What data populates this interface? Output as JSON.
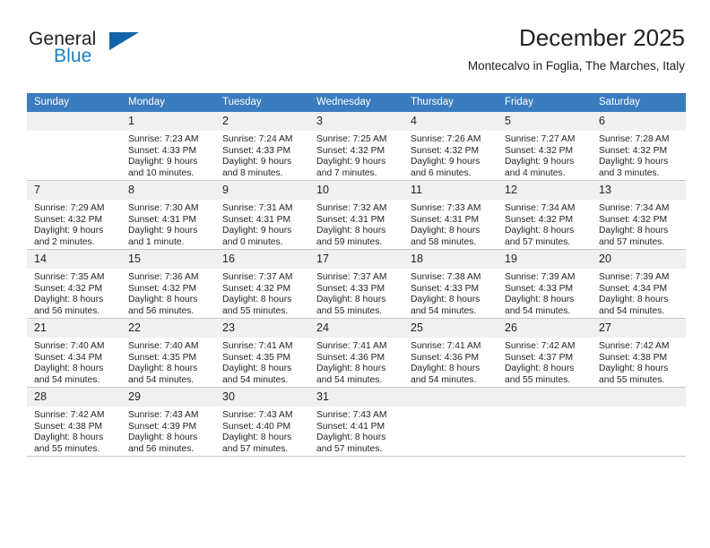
{
  "brand": {
    "name_top": "General",
    "name_bottom": "Blue",
    "triangle_color": "#1164ab",
    "blue_color": "#1a7fc1"
  },
  "header": {
    "title": "December 2025",
    "location": "Montecalvo in Foglia, The Marches, Italy"
  },
  "theme": {
    "header_row_bg": "#3a7cbe",
    "daynum_bg": "#f0f0f0",
    "cell_border": "#c8c8c8",
    "text_color": "#231f20"
  },
  "weekday_headers": [
    "Sunday",
    "Monday",
    "Tuesday",
    "Wednesday",
    "Thursday",
    "Friday",
    "Saturday"
  ],
  "weeks": [
    [
      {
        "day": "",
        "empty": true,
        "sunrise": "",
        "sunset": "",
        "daylight_line1": "",
        "daylight_line2": ""
      },
      {
        "day": "1",
        "empty": false,
        "sunrise": "Sunrise: 7:23 AM",
        "sunset": "Sunset: 4:33 PM",
        "daylight_line1": "Daylight: 9 hours",
        "daylight_line2": "and 10 minutes."
      },
      {
        "day": "2",
        "empty": false,
        "sunrise": "Sunrise: 7:24 AM",
        "sunset": "Sunset: 4:33 PM",
        "daylight_line1": "Daylight: 9 hours",
        "daylight_line2": "and 8 minutes."
      },
      {
        "day": "3",
        "empty": false,
        "sunrise": "Sunrise: 7:25 AM",
        "sunset": "Sunset: 4:32 PM",
        "daylight_line1": "Daylight: 9 hours",
        "daylight_line2": "and 7 minutes."
      },
      {
        "day": "4",
        "empty": false,
        "sunrise": "Sunrise: 7:26 AM",
        "sunset": "Sunset: 4:32 PM",
        "daylight_line1": "Daylight: 9 hours",
        "daylight_line2": "and 6 minutes."
      },
      {
        "day": "5",
        "empty": false,
        "sunrise": "Sunrise: 7:27 AM",
        "sunset": "Sunset: 4:32 PM",
        "daylight_line1": "Daylight: 9 hours",
        "daylight_line2": "and 4 minutes."
      },
      {
        "day": "6",
        "empty": false,
        "sunrise": "Sunrise: 7:28 AM",
        "sunset": "Sunset: 4:32 PM",
        "daylight_line1": "Daylight: 9 hours",
        "daylight_line2": "and 3 minutes."
      }
    ],
    [
      {
        "day": "7",
        "empty": false,
        "sunrise": "Sunrise: 7:29 AM",
        "sunset": "Sunset: 4:32 PM",
        "daylight_line1": "Daylight: 9 hours",
        "daylight_line2": "and 2 minutes."
      },
      {
        "day": "8",
        "empty": false,
        "sunrise": "Sunrise: 7:30 AM",
        "sunset": "Sunset: 4:31 PM",
        "daylight_line1": "Daylight: 9 hours",
        "daylight_line2": "and 1 minute."
      },
      {
        "day": "9",
        "empty": false,
        "sunrise": "Sunrise: 7:31 AM",
        "sunset": "Sunset: 4:31 PM",
        "daylight_line1": "Daylight: 9 hours",
        "daylight_line2": "and 0 minutes."
      },
      {
        "day": "10",
        "empty": false,
        "sunrise": "Sunrise: 7:32 AM",
        "sunset": "Sunset: 4:31 PM",
        "daylight_line1": "Daylight: 8 hours",
        "daylight_line2": "and 59 minutes."
      },
      {
        "day": "11",
        "empty": false,
        "sunrise": "Sunrise: 7:33 AM",
        "sunset": "Sunset: 4:31 PM",
        "daylight_line1": "Daylight: 8 hours",
        "daylight_line2": "and 58 minutes."
      },
      {
        "day": "12",
        "empty": false,
        "sunrise": "Sunrise: 7:34 AM",
        "sunset": "Sunset: 4:32 PM",
        "daylight_line1": "Daylight: 8 hours",
        "daylight_line2": "and 57 minutes."
      },
      {
        "day": "13",
        "empty": false,
        "sunrise": "Sunrise: 7:34 AM",
        "sunset": "Sunset: 4:32 PM",
        "daylight_line1": "Daylight: 8 hours",
        "daylight_line2": "and 57 minutes."
      }
    ],
    [
      {
        "day": "14",
        "empty": false,
        "sunrise": "Sunrise: 7:35 AM",
        "sunset": "Sunset: 4:32 PM",
        "daylight_line1": "Daylight: 8 hours",
        "daylight_line2": "and 56 minutes."
      },
      {
        "day": "15",
        "empty": false,
        "sunrise": "Sunrise: 7:36 AM",
        "sunset": "Sunset: 4:32 PM",
        "daylight_line1": "Daylight: 8 hours",
        "daylight_line2": "and 56 minutes."
      },
      {
        "day": "16",
        "empty": false,
        "sunrise": "Sunrise: 7:37 AM",
        "sunset": "Sunset: 4:32 PM",
        "daylight_line1": "Daylight: 8 hours",
        "daylight_line2": "and 55 minutes."
      },
      {
        "day": "17",
        "empty": false,
        "sunrise": "Sunrise: 7:37 AM",
        "sunset": "Sunset: 4:33 PM",
        "daylight_line1": "Daylight: 8 hours",
        "daylight_line2": "and 55 minutes."
      },
      {
        "day": "18",
        "empty": false,
        "sunrise": "Sunrise: 7:38 AM",
        "sunset": "Sunset: 4:33 PM",
        "daylight_line1": "Daylight: 8 hours",
        "daylight_line2": "and 54 minutes."
      },
      {
        "day": "19",
        "empty": false,
        "sunrise": "Sunrise: 7:39 AM",
        "sunset": "Sunset: 4:33 PM",
        "daylight_line1": "Daylight: 8 hours",
        "daylight_line2": "and 54 minutes."
      },
      {
        "day": "20",
        "empty": false,
        "sunrise": "Sunrise: 7:39 AM",
        "sunset": "Sunset: 4:34 PM",
        "daylight_line1": "Daylight: 8 hours",
        "daylight_line2": "and 54 minutes."
      }
    ],
    [
      {
        "day": "21",
        "empty": false,
        "sunrise": "Sunrise: 7:40 AM",
        "sunset": "Sunset: 4:34 PM",
        "daylight_line1": "Daylight: 8 hours",
        "daylight_line2": "and 54 minutes."
      },
      {
        "day": "22",
        "empty": false,
        "sunrise": "Sunrise: 7:40 AM",
        "sunset": "Sunset: 4:35 PM",
        "daylight_line1": "Daylight: 8 hours",
        "daylight_line2": "and 54 minutes."
      },
      {
        "day": "23",
        "empty": false,
        "sunrise": "Sunrise: 7:41 AM",
        "sunset": "Sunset: 4:35 PM",
        "daylight_line1": "Daylight: 8 hours",
        "daylight_line2": "and 54 minutes."
      },
      {
        "day": "24",
        "empty": false,
        "sunrise": "Sunrise: 7:41 AM",
        "sunset": "Sunset: 4:36 PM",
        "daylight_line1": "Daylight: 8 hours",
        "daylight_line2": "and 54 minutes."
      },
      {
        "day": "25",
        "empty": false,
        "sunrise": "Sunrise: 7:41 AM",
        "sunset": "Sunset: 4:36 PM",
        "daylight_line1": "Daylight: 8 hours",
        "daylight_line2": "and 54 minutes."
      },
      {
        "day": "26",
        "empty": false,
        "sunrise": "Sunrise: 7:42 AM",
        "sunset": "Sunset: 4:37 PM",
        "daylight_line1": "Daylight: 8 hours",
        "daylight_line2": "and 55 minutes."
      },
      {
        "day": "27",
        "empty": false,
        "sunrise": "Sunrise: 7:42 AM",
        "sunset": "Sunset: 4:38 PM",
        "daylight_line1": "Daylight: 8 hours",
        "daylight_line2": "and 55 minutes."
      }
    ],
    [
      {
        "day": "28",
        "empty": false,
        "sunrise": "Sunrise: 7:42 AM",
        "sunset": "Sunset: 4:38 PM",
        "daylight_line1": "Daylight: 8 hours",
        "daylight_line2": "and 55 minutes."
      },
      {
        "day": "29",
        "empty": false,
        "sunrise": "Sunrise: 7:43 AM",
        "sunset": "Sunset: 4:39 PM",
        "daylight_line1": "Daylight: 8 hours",
        "daylight_line2": "and 56 minutes."
      },
      {
        "day": "30",
        "empty": false,
        "sunrise": "Sunrise: 7:43 AM",
        "sunset": "Sunset: 4:40 PM",
        "daylight_line1": "Daylight: 8 hours",
        "daylight_line2": "and 57 minutes."
      },
      {
        "day": "31",
        "empty": false,
        "sunrise": "Sunrise: 7:43 AM",
        "sunset": "Sunset: 4:41 PM",
        "daylight_line1": "Daylight: 8 hours",
        "daylight_line2": "and 57 minutes."
      },
      {
        "day": "",
        "empty": true,
        "sunrise": "",
        "sunset": "",
        "daylight_line1": "",
        "daylight_line2": ""
      },
      {
        "day": "",
        "empty": true,
        "sunrise": "",
        "sunset": "",
        "daylight_line1": "",
        "daylight_line2": ""
      },
      {
        "day": "",
        "empty": true,
        "sunrise": "",
        "sunset": "",
        "daylight_line1": "",
        "daylight_line2": ""
      }
    ]
  ]
}
